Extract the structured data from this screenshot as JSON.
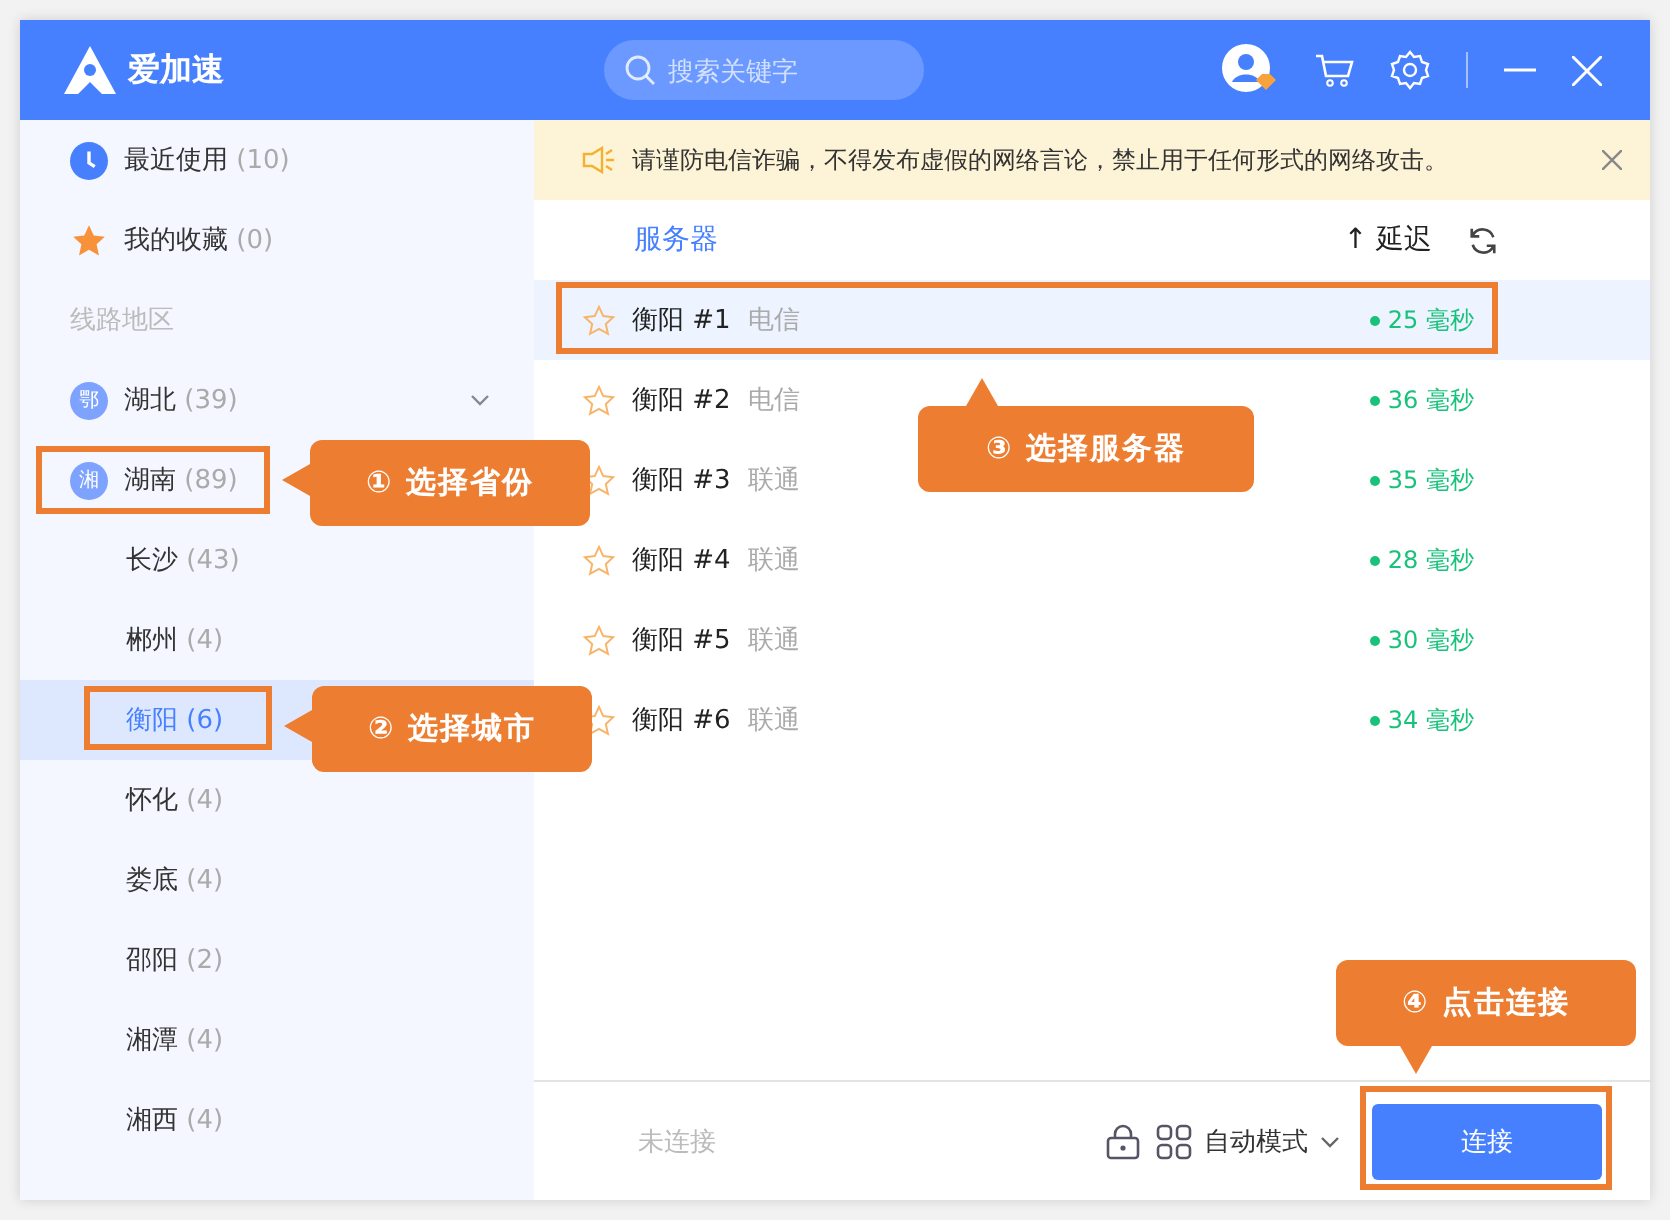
{
  "app": {
    "title": "爱加速",
    "search": {
      "placeholder": "搜索关键字"
    }
  },
  "sidebar": {
    "quick": [
      {
        "kind": "recent",
        "label": "最近使用",
        "count": "(10)"
      },
      {
        "kind": "favorite",
        "label": "我的收藏",
        "count": "(0)"
      }
    ],
    "section_label": "线路地区",
    "regions": [
      {
        "badge": "鄂",
        "name": "湖北",
        "count": "(39)",
        "expanded": false
      },
      {
        "badge": "湘",
        "name": "湖南",
        "count": "(89)",
        "expanded": true,
        "children": [
          {
            "name": "长沙",
            "count": "(43)",
            "selected": false
          },
          {
            "name": "郴州",
            "count": "(4)",
            "selected": false
          },
          {
            "name": "衡阳",
            "count": "(6)",
            "selected": true
          },
          {
            "name": "怀化",
            "count": "(4)",
            "selected": false
          },
          {
            "name": "娄底",
            "count": "(4)",
            "selected": false
          },
          {
            "name": "邵阳",
            "count": "(2)",
            "selected": false
          },
          {
            "name": "湘潭",
            "count": "(4)",
            "selected": false
          },
          {
            "name": "湘西",
            "count": "(4)",
            "selected": false
          }
        ]
      }
    ]
  },
  "notice": {
    "text": "请谨防电信诈骗，不得发布虚假的网络言论，禁止用于任何形式的网络攻击。"
  },
  "table": {
    "columns": {
      "server": "服务器",
      "sort_arrow": "↑",
      "latency": "延迟"
    },
    "rows": [
      {
        "name": "衡阳 #1",
        "isp": "电信",
        "latency": "25 毫秒",
        "selected": true,
        "favorite": false
      },
      {
        "name": "衡阳 #2",
        "isp": "电信",
        "latency": "36 毫秒",
        "selected": false,
        "favorite": false
      },
      {
        "name": "衡阳 #3",
        "isp": "联通",
        "latency": "35 毫秒",
        "selected": false,
        "favorite": false
      },
      {
        "name": "衡阳 #4",
        "isp": "联通",
        "latency": "28 毫秒",
        "selected": false,
        "favorite": false
      },
      {
        "name": "衡阳 #5",
        "isp": "联通",
        "latency": "30 毫秒",
        "selected": false,
        "favorite": false
      },
      {
        "name": "衡阳 #6",
        "isp": "联通",
        "latency": "34 毫秒",
        "selected": false,
        "favorite": false
      }
    ]
  },
  "footer": {
    "status": "未连接",
    "mode": "自动模式",
    "connect": "连接"
  },
  "annotations": [
    {
      "text": "① 选择省份"
    },
    {
      "text": "② 选择城市"
    },
    {
      "text": "③ 选择服务器"
    },
    {
      "text": "④ 点击连接"
    }
  ]
}
